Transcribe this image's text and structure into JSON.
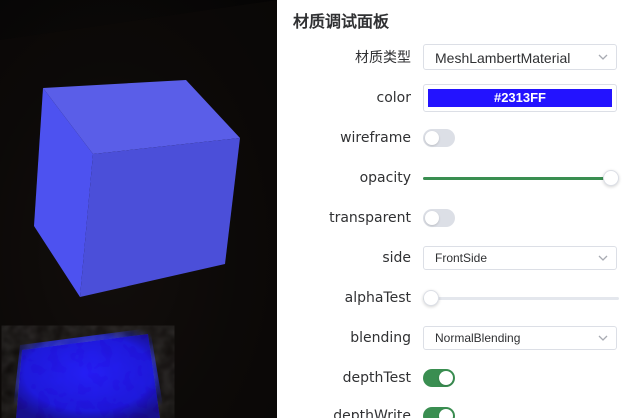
{
  "viewport": {
    "cube_color": "#4a4fe6",
    "floor_glow_color": "#2313FF"
  },
  "panel": {
    "title": "材质调试面板",
    "material_type": {
      "label": "材质类型",
      "value": "MeshLambertMaterial"
    },
    "color": {
      "label": "color",
      "value": "#2313FF"
    },
    "wireframe": {
      "label": "wireframe",
      "on": false
    },
    "opacity": {
      "label": "opacity",
      "value": 1.0
    },
    "transparent": {
      "label": "transparent",
      "on": false
    },
    "side": {
      "label": "side",
      "value": "FrontSide"
    },
    "alphaTest": {
      "label": "alphaTest",
      "value": 0.0
    },
    "blending": {
      "label": "blending",
      "value": "NormalBlending"
    },
    "depthTest": {
      "label": "depthTest",
      "on": true
    },
    "depthWrite": {
      "label": "depthWrite",
      "on": true
    }
  },
  "colors": {
    "accent": "#3a8e51",
    "border": "#dcdfe6"
  }
}
